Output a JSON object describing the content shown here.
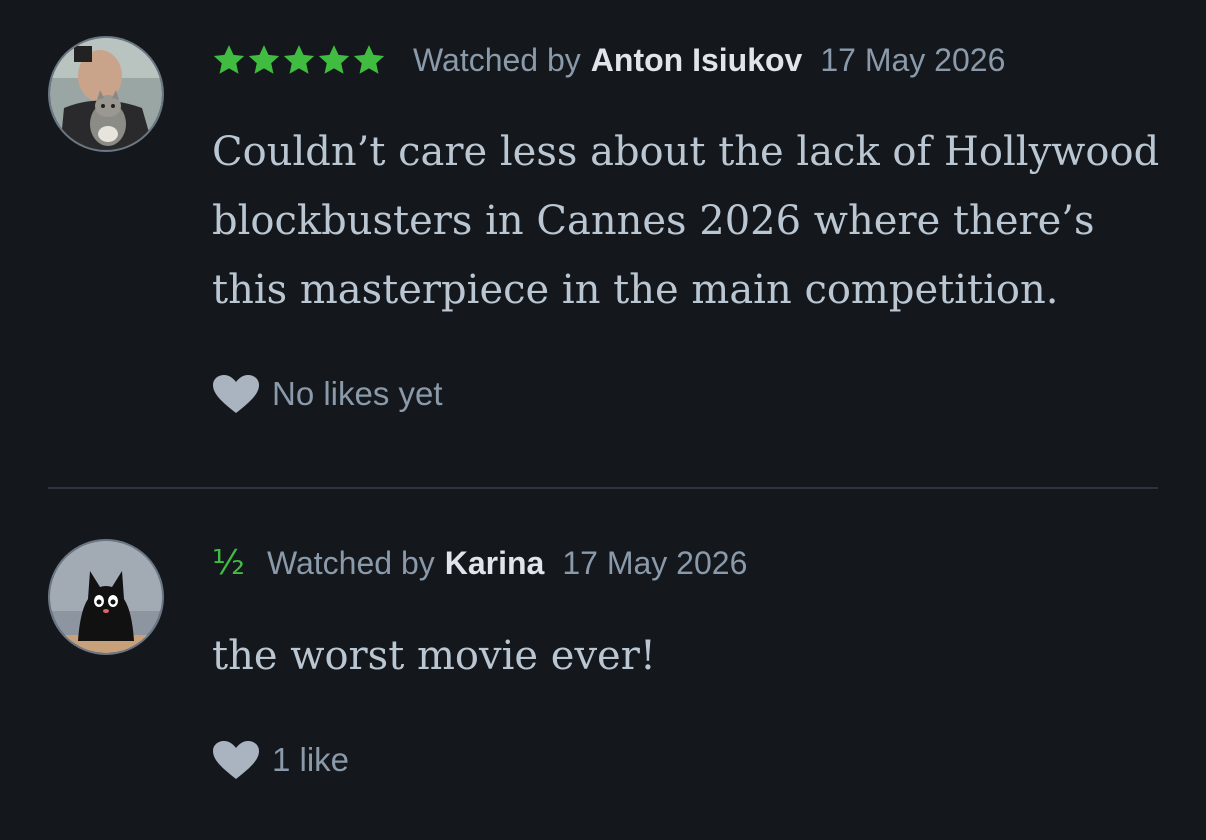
{
  "reviews": [
    {
      "rating_display": "★★★★★",
      "rating_value": 5,
      "watched_by_label": "Watched by",
      "username": "Anton Isiukov",
      "date": "17 May 2026",
      "text": "Couldn’t care less about the lack of Hollywood blockbusters in Cannes 2026 where there’s this masterpiece in the main competition.",
      "likes_text": "No likes yet",
      "avatar_icon": "person-holding-cat-avatar"
    },
    {
      "rating_display": "½",
      "rating_value": 0.5,
      "watched_by_label": "Watched by",
      "username": "Karina",
      "date": "17 May 2026",
      "text": "the worst movie ever!",
      "likes_text": "1 like",
      "avatar_icon": "black-cat-avatar"
    }
  ],
  "colors": {
    "background": "#14181c",
    "star_green": "#40bc40",
    "meta_gray": "#8a9aab",
    "username_white": "#dfe5ea",
    "body_text": "#bac6d2",
    "heart_gray": "#a9b4c0",
    "divider": "#2c3440"
  }
}
